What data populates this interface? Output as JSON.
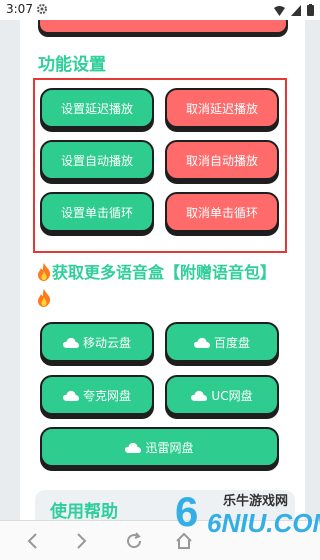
{
  "status_bar": {
    "time": "3:07"
  },
  "settings": {
    "title": "功能设置",
    "buttons": [
      {
        "label": "设置延迟播放",
        "color": "green"
      },
      {
        "label": "取消延迟播放",
        "color": "red"
      },
      {
        "label": "设置自动播放",
        "color": "green"
      },
      {
        "label": "取消自动播放",
        "color": "red"
      },
      {
        "label": "设置单击循环",
        "color": "green"
      },
      {
        "label": "取消单击循环",
        "color": "red"
      }
    ]
  },
  "download": {
    "title": "获取更多语音盒【附赠语音包】",
    "disks": [
      {
        "label": "移动云盘"
      },
      {
        "label": "百度盘"
      },
      {
        "label": "夸克网盘"
      },
      {
        "label": "UC网盘"
      },
      {
        "label": "迅雷网盘"
      }
    ]
  },
  "help": {
    "title": "使用帮助"
  },
  "watermark": {
    "site_name": "乐牛游戏网",
    "logo_text": "6NIU.COM"
  },
  "colors": {
    "accent": "#2ecf9a",
    "green_button": "#2fcc8f",
    "red_button": "#ff6b6b",
    "highlight_border": "#e53935",
    "brand_blue": "#33aee6"
  },
  "icons": {
    "fire": "fire-icon",
    "cloud": "cloud-icon"
  }
}
